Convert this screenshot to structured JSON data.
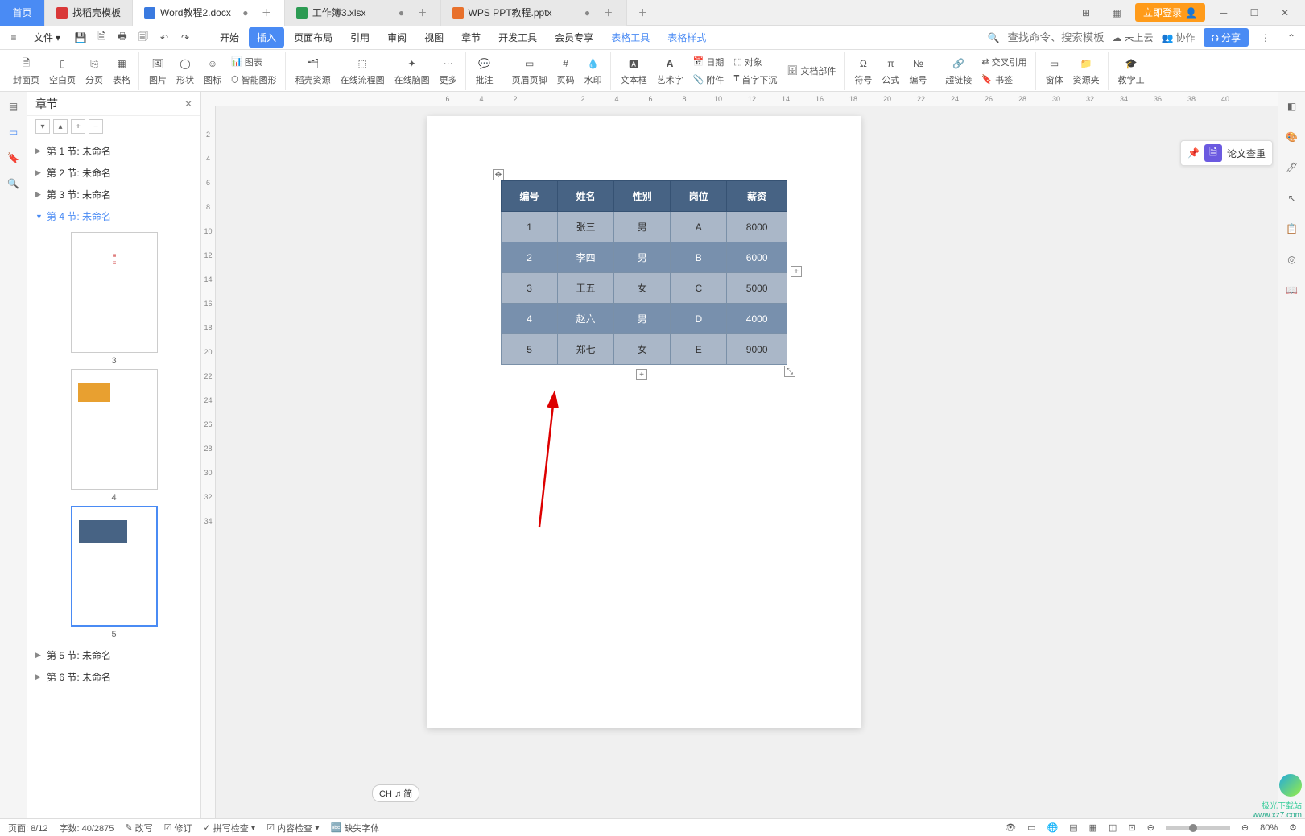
{
  "tabs": {
    "home": "首页",
    "find_template": "找稻壳模板",
    "doc": "Word教程2.docx",
    "xls": "工作簿3.xlsx",
    "ppt": "WPS PPT教程.pptx"
  },
  "header": {
    "login": "立即登录",
    "file": "文件",
    "search_placeholder": "查找命令、搜索模板",
    "cloud": "未上云",
    "collab": "协作",
    "share": "分享"
  },
  "menu": {
    "start": "开始",
    "insert": "插入",
    "layout": "页面布局",
    "reference": "引用",
    "review": "审阅",
    "view": "视图",
    "chapter": "章节",
    "devtools": "开发工具",
    "vip": "会员专享",
    "table_tool": "表格工具",
    "table_style": "表格样式"
  },
  "ribbon": {
    "cover": "封面页",
    "blank": "空白页",
    "pagebreak": "分页",
    "table": "表格",
    "picture": "图片",
    "shape": "形状",
    "icon": "图标",
    "smartart": "智能图形",
    "chart": "图表",
    "resource": "稻壳资源",
    "flowchart": "在线流程图",
    "mindmap": "在线脑图",
    "more": "更多",
    "comment": "批注",
    "headerfooter": "页眉页脚",
    "pagenumber": "页码",
    "watermark": "水印",
    "textbox": "文本框",
    "wordart": "艺术字",
    "date": "日期",
    "object": "对象",
    "dropcap": "首字下沉",
    "attachment": "附件",
    "docpart": "文档部件",
    "symbol": "符号",
    "equation": "公式",
    "number": "编号",
    "hyperlink": "超链接",
    "crossref": "交叉引用",
    "bookmark": "书签",
    "window": "窗体",
    "resfolder": "资源夹",
    "teach": "教学工"
  },
  "sidebar": {
    "title": "章节",
    "sections": {
      "s1": "第 1 节: 未命名",
      "s2": "第 2 节: 未命名",
      "s3": "第 3 节: 未命名",
      "s4": "第 4 节: 未命名",
      "s5": "第 5 节: 未命名",
      "s6": "第 6 节: 未命名"
    },
    "thumbs": {
      "p3": "3",
      "p4": "4",
      "p5": "5"
    }
  },
  "doc_table": {
    "headers": {
      "c1": "编号",
      "c2": "姓名",
      "c3": "性别",
      "c4": "岗位",
      "c5": "薪资"
    },
    "rows": [
      {
        "c1": "1",
        "c2": "张三",
        "c3": "男",
        "c4": "A",
        "c5": "8000"
      },
      {
        "c1": "2",
        "c2": "李四",
        "c3": "男",
        "c4": "B",
        "c5": "6000"
      },
      {
        "c1": "3",
        "c2": "王五",
        "c3": "女",
        "c4": "C",
        "c5": "5000"
      },
      {
        "c1": "4",
        "c2": "赵六",
        "c3": "男",
        "c4": "D",
        "c5": "4000"
      },
      {
        "c1": "5",
        "c2": "郑七",
        "c3": "女",
        "c4": "E",
        "c5": "9000"
      }
    ]
  },
  "floating": {
    "plagiarism": "论文查重"
  },
  "ime": "CH ♫ 简",
  "status": {
    "page": "页面: 8/12",
    "words": "字数: 40/2875",
    "rewrite": "改写",
    "revision": "修订",
    "spell": "拼写检查",
    "content": "内容检查",
    "missing_font": "缺失字体",
    "zoom": "80%"
  },
  "ruler_h": [
    "",
    "6",
    "",
    "4",
    "",
    "2",
    "",
    "",
    "",
    "2",
    "",
    "4",
    "",
    "6",
    "",
    "8",
    "",
    "10",
    "",
    "12",
    "",
    "14",
    "",
    "16",
    "",
    "18",
    "",
    "20",
    "",
    "22",
    "",
    "24",
    "",
    "26",
    "",
    "28",
    "",
    "30",
    "",
    "32",
    "",
    "34",
    "",
    "36",
    "",
    "38",
    "",
    "40"
  ],
  "watermark": {
    "name": "极光下载站",
    "url": "www.xz7.com"
  }
}
